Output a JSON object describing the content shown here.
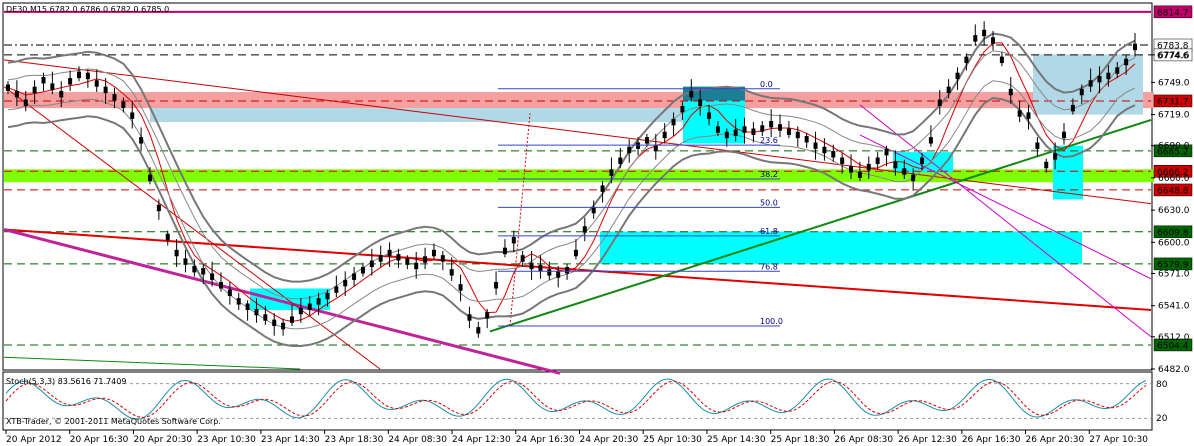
{
  "header": {
    "symbol_line": "DE30,M15  6782.0 6786.0 6782.0 6785.0",
    "copyright": "XTB-Trader, © 2001-2011 MetaQuotes Software Corp."
  },
  "indicator": {
    "label": "Stoch(5,3,3) 83.5616 71.7409",
    "levels": [
      "80",
      "20"
    ]
  },
  "chart_data": {
    "type": "line",
    "title": "DE30,M15",
    "ylim": [
      6482.0,
      6822.0
    ],
    "y_ticks": [
      "6774.6",
      "6749.0",
      "6719.0",
      "6690.0",
      "6660.0",
      "6630.0",
      "6600.0",
      "6571.0",
      "6541.0",
      "6512.0",
      "6482.0"
    ],
    "x_ticks": [
      "20 Apr 2012",
      "20 Apr 16:30",
      "20 Apr 20:30",
      "23 Apr 10:30",
      "23 Apr 14:30",
      "23 Apr 18:30",
      "24 Apr 08:30",
      "24 Apr 12:30",
      "24 Apr 16:30",
      "24 Apr 20:30",
      "25 Apr 10:30",
      "25 Apr 14:30",
      "25 Apr 18:30",
      "26 Apr 08:30",
      "26 Apr 12:30",
      "26 Apr 16:30",
      "26 Apr 20:30",
      "27 Apr 10:30"
    ],
    "price_levels": [
      {
        "value": 6814.7,
        "label": "6814.7",
        "color": "#c0006a",
        "style": "solid"
      },
      {
        "value": 6783.8,
        "label": "6783.8",
        "color": "#000000",
        "style": "dashdot"
      },
      {
        "value": 6774.6,
        "label": "6774.6",
        "color": "#000000",
        "style": "dash"
      },
      {
        "value": 6731.7,
        "label": "6731.7",
        "color": "#cc0000",
        "style": "dash"
      },
      {
        "value": 6685.2,
        "label": "6685.2",
        "color": "#006400",
        "style": "dash"
      },
      {
        "value": 6666.2,
        "label": "6666.2",
        "color": "#cc0000",
        "style": "dash"
      },
      {
        "value": 6648.8,
        "label": "6648.8",
        "color": "#cc0000",
        "style": "dash"
      },
      {
        "value": 6609.8,
        "label": "6609.8",
        "color": "#006400",
        "style": "dash"
      },
      {
        "value": 6579.9,
        "label": "6579.9",
        "color": "#006400",
        "style": "dash"
      },
      {
        "value": 6504.4,
        "label": "6504.4",
        "color": "#006400",
        "style": "dash"
      }
    ],
    "fibonacci": {
      "levels": [
        {
          "ratio": "0.0",
          "value": 6743.0
        },
        {
          "ratio": "23.6",
          "value": 6690.5
        },
        {
          "ratio": "38.2",
          "value": 6659.0
        },
        {
          "ratio": "50.0",
          "value": 6632.5
        },
        {
          "ratio": "61.8",
          "value": 6606.0
        },
        {
          "ratio": "76.8",
          "value": 6573.0
        },
        {
          "ratio": "100.0",
          "value": 6522.0
        }
      ]
    },
    "close_path": [
      6744,
      6738,
      6730,
      6742,
      6751,
      6745,
      6738,
      6750,
      6756,
      6755,
      6748,
      6742,
      6735,
      6728,
      6718,
      6695,
      6660,
      6632,
      6605,
      6590,
      6582,
      6575,
      6573,
      6568,
      6560,
      6553,
      6545,
      6540,
      6535,
      6530,
      6525,
      6522,
      6528,
      6536,
      6540,
      6545,
      6550,
      6556,
      6562,
      6568,
      6574,
      6580,
      6585,
      6590,
      6586,
      6582,
      6578,
      6584,
      6590,
      6585,
      6572,
      6558,
      6530,
      6518,
      6532,
      6560,
      6592,
      6602,
      6585,
      6578,
      6576,
      6572,
      6570,
      6574,
      6590,
      6612,
      6630,
      6650,
      6665,
      6676,
      6686,
      6690,
      6695,
      6688,
      6700,
      6712,
      6724,
      6738,
      6730,
      6718,
      6705,
      6700,
      6702,
      6705,
      6703,
      6706,
      6710,
      6707,
      6703,
      6700,
      6696,
      6690,
      6686,
      6682,
      6676,
      6668,
      6663,
      6670,
      6676,
      6684,
      6672,
      6666,
      6660,
      6676,
      6695,
      6730,
      6742,
      6755,
      6770,
      6790,
      6795,
      6788,
      6770,
      6740,
      6720,
      6718,
      6690,
      6672,
      6680,
      6700,
      6725,
      6740,
      6748,
      6752,
      6755,
      6760,
      6768,
      6782
    ]
  }
}
